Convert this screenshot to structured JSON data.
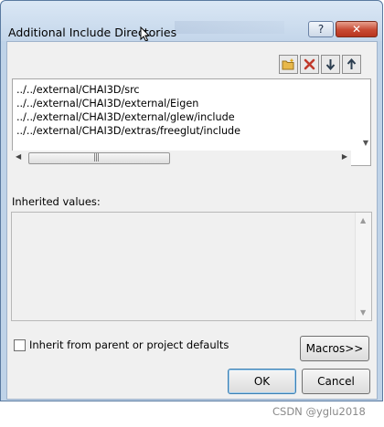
{
  "dialog": {
    "title": "Additional Include Directories",
    "help_button_label": "?",
    "close_button_label": "✕"
  },
  "toolbar": {
    "new_line_icon": "folder-new-icon",
    "delete_icon": "delete-x-icon",
    "move_down_icon": "arrow-down-icon",
    "move_up_icon": "arrow-up-icon"
  },
  "directories": [
    "../../external/CHAI3D/src",
    "../../external/CHAI3D/external/Eigen",
    "../../external/CHAI3D/external/glew/include",
    "../../external/CHAI3D/extras/freeglut/include"
  ],
  "inherited": {
    "label": "Inherited values:"
  },
  "inherit_checkbox": {
    "label": "Inherit from parent or project defaults",
    "checked": false
  },
  "buttons": {
    "macros": "Macros>>",
    "ok": "OK",
    "cancel": "Cancel"
  },
  "watermark": "CSDN @yglu2018",
  "colors": {
    "delete_red": "#c0392b",
    "arrow_dark": "#2c3e50",
    "folder_yellow": "#e8b84a"
  }
}
